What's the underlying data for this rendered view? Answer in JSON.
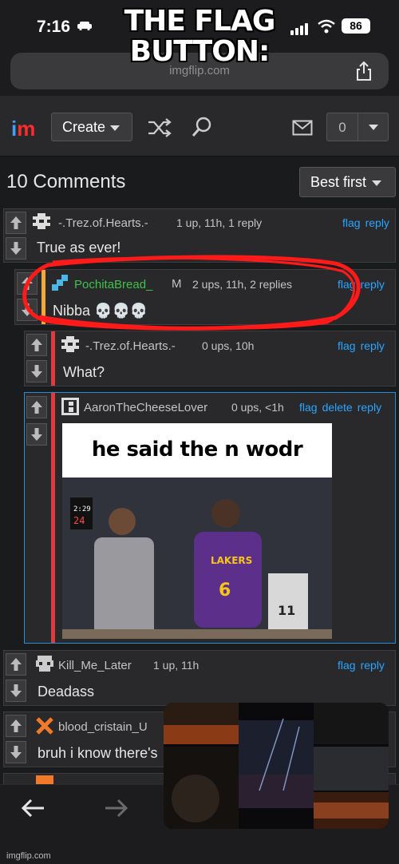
{
  "caption": "THE FLAG BUTTON:",
  "status_bar": {
    "time": "7:16",
    "battery": "86"
  },
  "address_bar": {
    "url": "imgflip.com"
  },
  "nav": {
    "create_label": "Create",
    "notif_count": "0"
  },
  "comments_header": {
    "title": "10 Comments",
    "sort_label": "Best first"
  },
  "comments": [
    {
      "user": "-.Trez.of.Hearts.-",
      "meta": "1 up, 11h, 1 reply",
      "flag": "flag",
      "reply": "reply",
      "text": "True as ever!"
    },
    {
      "user": "PochitaBread_",
      "badge": "M",
      "meta": "2 ups, 11h, 2 replies",
      "flag": "flag",
      "reply": "reply",
      "text": "Nibba 💀💀💀"
    },
    {
      "user": "-.Trez.of.Hearts.-",
      "meta": "0 ups, 10h",
      "flag": "flag",
      "reply": "reply",
      "text": "What?"
    },
    {
      "user": "AaronTheCheeseLover",
      "meta": "0 ups, <1h",
      "flag": "flag",
      "delete": "delete",
      "reply": "reply",
      "meme_caption": "he said the n wodr"
    },
    {
      "user": "Kill_Me_Later",
      "meta": "1 up, 11h",
      "flag": "flag",
      "reply": "reply",
      "text": "Deadass"
    },
    {
      "user": "blood_cristain_U",
      "text": "bruh i know there's"
    }
  ],
  "footer": {
    "watermark": "imgflip.com"
  },
  "colors": {
    "accent": "#29a6ff",
    "reply_bar_red": "#e0393e",
    "reply_bar_orange": "#f2a93b",
    "green_user": "#3fc24a",
    "circle": "#ff1a1a"
  },
  "icons": [
    "car-icon",
    "signal-icon",
    "wifi-icon",
    "share-icon",
    "shuffle-icon",
    "search-icon",
    "mail-icon",
    "upvote-icon",
    "downvote-icon",
    "back-arrow-icon",
    "forward-arrow-icon"
  ]
}
